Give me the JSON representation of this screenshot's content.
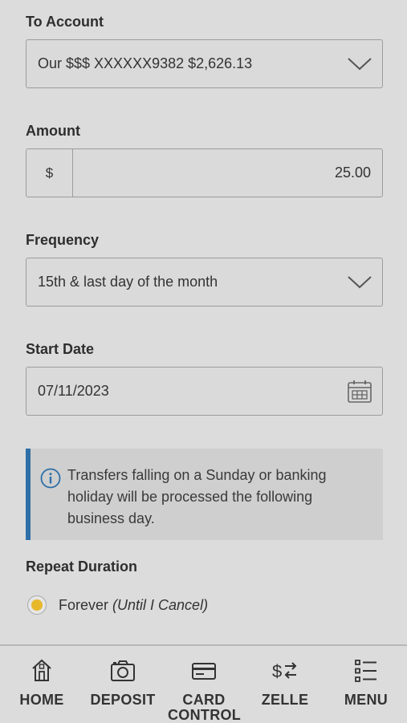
{
  "to_account": {
    "label": "To Account",
    "selected": "Our $$$  XXXXXX9382  $2,626.13"
  },
  "amount": {
    "label": "Amount",
    "currency": "$",
    "value": "25.00"
  },
  "frequency": {
    "label": "Frequency",
    "selected": "15th & last day of the month"
  },
  "start_date": {
    "label": "Start Date",
    "value": "07/11/2023"
  },
  "notice": {
    "text": "Transfers falling on a Sunday or banking holiday will be processed the following business day."
  },
  "repeat": {
    "label": "Repeat Duration",
    "option_main": "Forever",
    "option_note": "(Until I Cancel)"
  },
  "nav": {
    "home": "HOME",
    "deposit": "DEPOSIT",
    "card_control": "CARD CONTROL",
    "zelle": "ZELLE",
    "menu": "MENU"
  },
  "colors": {
    "accent": "#2e6fa8",
    "radio": "#e8b82c",
    "background": "#dcdcdc"
  }
}
